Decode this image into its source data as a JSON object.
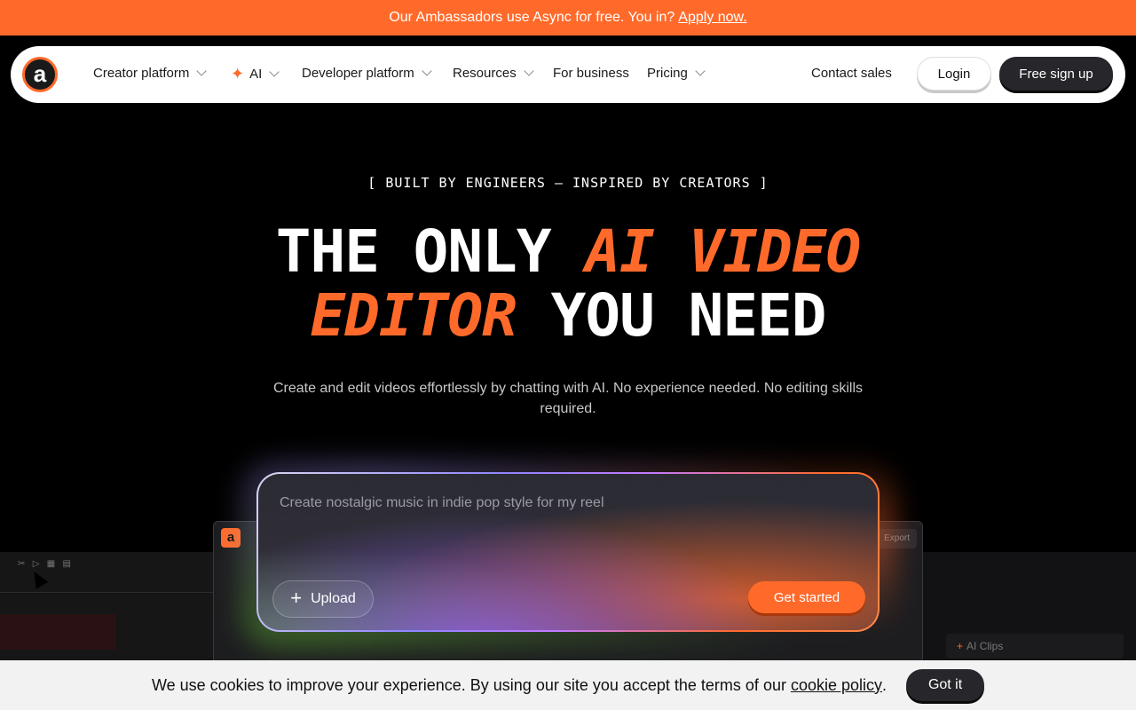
{
  "banner": {
    "text": "Our Ambassadors use Async for free. You in?",
    "link": "Apply now."
  },
  "nav": {
    "logo_letter": "a",
    "items": [
      {
        "label": "Creator platform"
      },
      {
        "label": "AI"
      },
      {
        "label": "Developer platform"
      },
      {
        "label": "Resources"
      },
      {
        "label": "For business"
      },
      {
        "label": "Pricing"
      }
    ],
    "contact": "Contact sales",
    "login": "Login",
    "signup": "Free sign up"
  },
  "hero": {
    "eyebrow": "[ BUILT BY ENGINEERS — INSPIRED BY CREATORS ]",
    "headline_1": "THE ONLY ",
    "headline_hl_1": "AI VIDEO",
    "headline_hl_2": "EDITOR",
    "headline_2": " YOU NEED",
    "subtitle": "Create and edit videos effortlessly by chatting with AI. No experience needed. No editing skills required."
  },
  "prompt": {
    "placeholder": "Create nostalgic music in indie pop style for my reel",
    "upload": "Upload",
    "submit": "Get started"
  },
  "editor_preview": {
    "logo_letter": "a",
    "export": "Export",
    "side_panel": "AI Clips"
  },
  "cookie": {
    "text": "We use cookies to improve your experience. By using our site you accept the terms of our",
    "link": "cookie policy",
    "end": ".",
    "button": "Got it"
  },
  "colors": {
    "accent": "#ff6a2b",
    "dark": "#26262b",
    "background": "#000000"
  }
}
